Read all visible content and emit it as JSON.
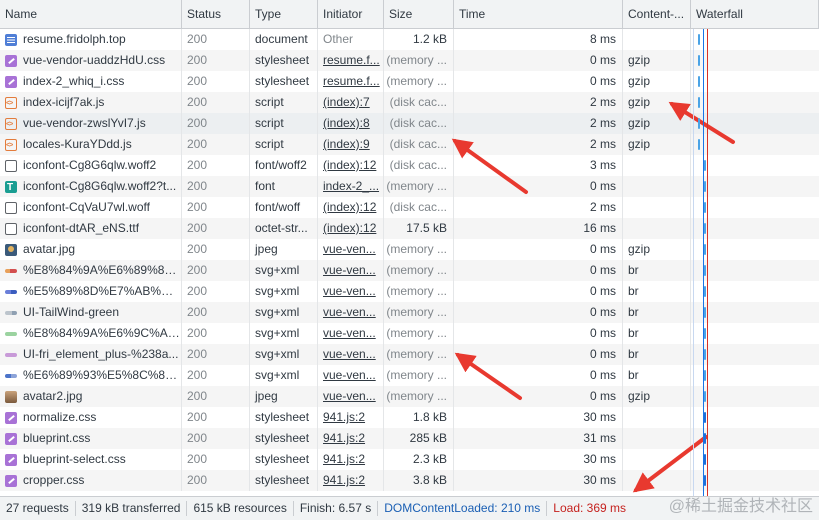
{
  "columns": [
    "Name",
    "Status",
    "Type",
    "Initiator",
    "Size",
    "Time",
    "Content-...",
    "Waterfall"
  ],
  "rows": [
    {
      "name": "resume.fridolph.top",
      "icon": "document-icon",
      "status": "200",
      "type": "document",
      "initiator": "Other",
      "init_link": false,
      "size": "1.2 kB",
      "size_grey": false,
      "time": "8 ms",
      "content": ""
    },
    {
      "name": "vue-vendor-uaddzHdU.css",
      "icon": "stylesheet-icon",
      "status": "200",
      "type": "stylesheet",
      "initiator": "resume.f...",
      "init_link": true,
      "size": "(memory ...",
      "size_grey": true,
      "time": "0 ms",
      "content": "gzip"
    },
    {
      "name": "index-2_whiq_i.css",
      "icon": "stylesheet-icon",
      "status": "200",
      "type": "stylesheet",
      "initiator": "resume.f...",
      "init_link": true,
      "size": "(memory ...",
      "size_grey": true,
      "time": "0 ms",
      "content": "gzip"
    },
    {
      "name": "index-icijf7ak.js",
      "icon": "script-icon",
      "status": "200",
      "type": "script",
      "initiator": "(index):7",
      "init_link": true,
      "size": "(disk cac...",
      "size_grey": true,
      "time": "2 ms",
      "content": "gzip"
    },
    {
      "name": "vue-vendor-zwslYvI7.js",
      "icon": "script-icon",
      "status": "200",
      "type": "script",
      "initiator": "(index):8",
      "init_link": true,
      "size": "(disk cac...",
      "size_grey": true,
      "time": "2 ms",
      "content": "gzip"
    },
    {
      "name": "locales-KuraYDdd.js",
      "icon": "script-icon",
      "status": "200",
      "type": "script",
      "initiator": "(index):9",
      "init_link": true,
      "size": "(disk cac...",
      "size_grey": true,
      "time": "2 ms",
      "content": "gzip"
    },
    {
      "name": "iconfont-Cg8G6qlw.woff2",
      "icon": "font-icon",
      "status": "200",
      "type": "font/woff2",
      "initiator": "(index):12",
      "init_link": true,
      "size": "(disk cac...",
      "size_grey": true,
      "time": "3 ms",
      "content": ""
    },
    {
      "name": "iconfont-Cg8G6qlw.woff2?t...",
      "icon": "font-t-icon",
      "status": "200",
      "type": "font",
      "initiator": "index-2_...",
      "init_link": true,
      "size": "(memory ...",
      "size_grey": true,
      "time": "0 ms",
      "content": ""
    },
    {
      "name": "iconfont-CqVaU7wl.woff",
      "icon": "font-icon",
      "status": "200",
      "type": "font/woff",
      "initiator": "(index):12",
      "init_link": true,
      "size": "(disk cac...",
      "size_grey": true,
      "time": "2 ms",
      "content": ""
    },
    {
      "name": "iconfont-dtAR_eNS.ttf",
      "icon": "font-icon",
      "status": "200",
      "type": "octet-str...",
      "initiator": "(index):12",
      "init_link": true,
      "size": "17.5 kB",
      "size_grey": false,
      "time": "16 ms",
      "content": ""
    },
    {
      "name": "avatar.jpg",
      "icon": "image-icon",
      "status": "200",
      "type": "jpeg",
      "initiator": "vue-ven...",
      "init_link": true,
      "size": "(memory ...",
      "size_grey": true,
      "time": "0 ms",
      "content": "gzip"
    },
    {
      "name": "%E8%84%9A%E6%89%8B...",
      "icon": "svg-icon-1",
      "status": "200",
      "type": "svg+xml",
      "initiator": "vue-ven...",
      "init_link": true,
      "size": "(memory ...",
      "size_grey": true,
      "time": "0 ms",
      "content": "br"
    },
    {
      "name": "%E5%89%8D%E7%AB%AF...",
      "icon": "svg-icon-2",
      "status": "200",
      "type": "svg+xml",
      "initiator": "vue-ven...",
      "init_link": true,
      "size": "(memory ...",
      "size_grey": true,
      "time": "0 ms",
      "content": "br"
    },
    {
      "name": "UI-TailWind-green",
      "icon": "svg-icon-3",
      "status": "200",
      "type": "svg+xml",
      "initiator": "vue-ven...",
      "init_link": true,
      "size": "(memory ...",
      "size_grey": true,
      "time": "0 ms",
      "content": "br"
    },
    {
      "name": "%E8%84%9A%E6%9C%AC...",
      "icon": "svg-icon-4",
      "status": "200",
      "type": "svg+xml",
      "initiator": "vue-ven...",
      "init_link": true,
      "size": "(memory ...",
      "size_grey": true,
      "time": "0 ms",
      "content": "br"
    },
    {
      "name": "UI-fri_element_plus-%238a...",
      "icon": "svg-icon-5",
      "status": "200",
      "type": "svg+xml",
      "initiator": "vue-ven...",
      "init_link": true,
      "size": "(memory ...",
      "size_grey": true,
      "time": "0 ms",
      "content": "br"
    },
    {
      "name": "%E6%89%93%E5%8C%85...",
      "icon": "svg-icon-6",
      "status": "200",
      "type": "svg+xml",
      "initiator": "vue-ven...",
      "init_link": true,
      "size": "(memory ...",
      "size_grey": true,
      "time": "0 ms",
      "content": "br"
    },
    {
      "name": "avatar2.jpg",
      "icon": "image-icon-2",
      "status": "200",
      "type": "jpeg",
      "initiator": "vue-ven...",
      "init_link": true,
      "size": "(memory ...",
      "size_grey": true,
      "time": "0 ms",
      "content": "gzip"
    },
    {
      "name": "normalize.css",
      "icon": "stylesheet-icon",
      "status": "200",
      "type": "stylesheet",
      "initiator": "941.js:2",
      "init_link": true,
      "size": "1.8 kB",
      "size_grey": false,
      "time": "30 ms",
      "content": ""
    },
    {
      "name": "blueprint.css",
      "icon": "stylesheet-icon",
      "status": "200",
      "type": "stylesheet",
      "initiator": "941.js:2",
      "init_link": true,
      "size": "285 kB",
      "size_grey": false,
      "time": "31 ms",
      "content": ""
    },
    {
      "name": "blueprint-select.css",
      "icon": "stylesheet-icon",
      "status": "200",
      "type": "stylesheet",
      "initiator": "941.js:2",
      "init_link": true,
      "size": "2.3 kB",
      "size_grey": false,
      "time": "30 ms",
      "content": ""
    },
    {
      "name": "cropper.css",
      "icon": "stylesheet-icon",
      "status": "200",
      "type": "stylesheet",
      "initiator": "941.js:2",
      "init_link": true,
      "size": "3.8 kB",
      "size_grey": false,
      "time": "30 ms",
      "content": ""
    }
  ],
  "status_bar": {
    "requests": "27 requests",
    "transferred": "319 kB transferred",
    "resources": "615 kB resources",
    "finish": "Finish: 6.57 s",
    "dom_content_loaded": "DOMContentLoaded: 210 ms",
    "load": "Load: 369 ms"
  },
  "watermark": "@稀土掘金技术社区",
  "colors": {
    "header_bg": "#f1f3f4",
    "grid_line": "#cacdd1",
    "dcl_line": "#1a73e8",
    "load_line": "#d93025",
    "annotation_arrow": "#e8392f"
  }
}
